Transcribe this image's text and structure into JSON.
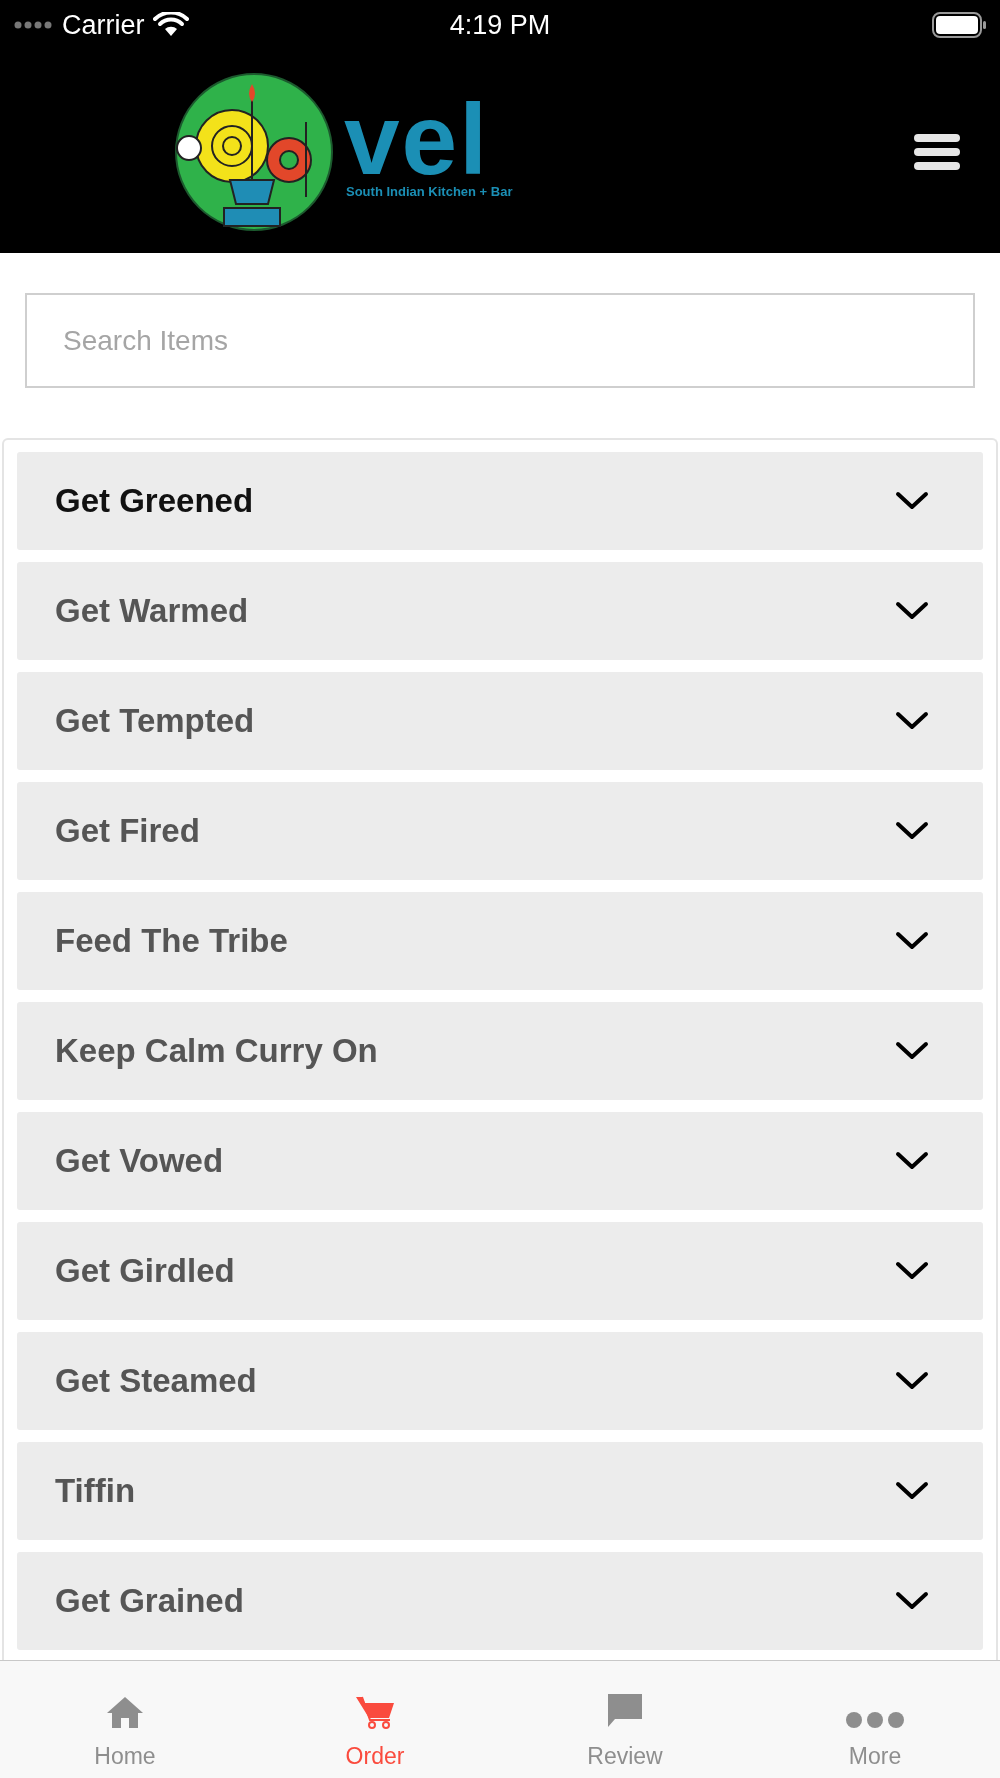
{
  "status_bar": {
    "carrier": "Carrier",
    "time": "4:19 PM"
  },
  "header": {
    "logo_text": "vel",
    "tagline": "South Indian Kitchen + Bar"
  },
  "search": {
    "placeholder": "Search Items"
  },
  "categories": [
    {
      "label": "Get Greened",
      "selected": true
    },
    {
      "label": "Get Warmed",
      "selected": false
    },
    {
      "label": "Get Tempted",
      "selected": false
    },
    {
      "label": "Get Fired",
      "selected": false
    },
    {
      "label": "Feed The Tribe",
      "selected": false
    },
    {
      "label": "Keep Calm Curry On",
      "selected": false
    },
    {
      "label": "Get Vowed",
      "selected": false
    },
    {
      "label": "Get Girdled",
      "selected": false
    },
    {
      "label": "Get Steamed",
      "selected": false
    },
    {
      "label": "Tiffin",
      "selected": false
    },
    {
      "label": "Get Grained",
      "selected": false
    }
  ],
  "tab_bar": [
    {
      "kind": "home",
      "label": "Home",
      "selected": false
    },
    {
      "kind": "order",
      "label": "Order",
      "selected": true
    },
    {
      "kind": "review",
      "label": "Review",
      "selected": false
    },
    {
      "kind": "more",
      "label": "More",
      "selected": false
    }
  ]
}
